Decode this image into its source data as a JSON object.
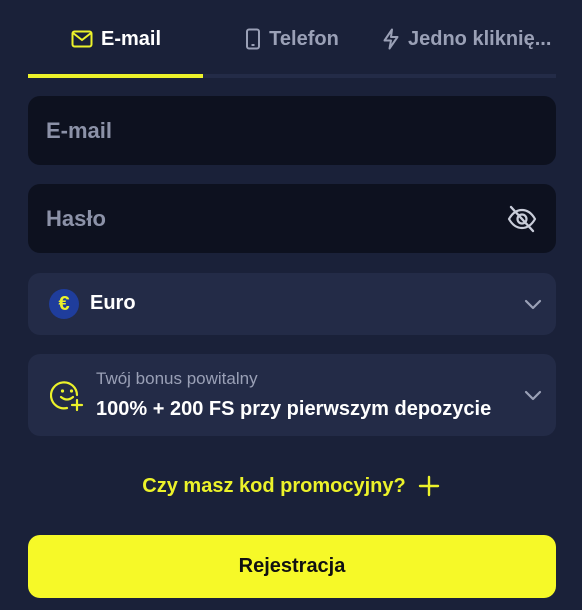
{
  "tabs": {
    "email": "E-mail",
    "phone": "Telefon",
    "one_click": "Jedno kliknię..."
  },
  "form": {
    "email_placeholder": "E-mail",
    "password_placeholder": "Hasło"
  },
  "currency": {
    "symbol": "€",
    "label": "Euro"
  },
  "bonus": {
    "caption": "Twój bonus powitalny",
    "value": "100% + 200 FS przy pierwszym depozycie"
  },
  "promo": {
    "label": "Czy masz kod promocyjny?"
  },
  "register": {
    "label": "Rejestracja"
  },
  "colors": {
    "background": "#1a2139",
    "accent": "#ecf22a",
    "input_bg": "#0d111f",
    "select_bg": "#232b47"
  },
  "icons": [
    "mail-icon",
    "phone-icon",
    "lightning-icon",
    "eye-off-icon",
    "euro-icon",
    "chevron-down-icon",
    "smiley-plus-icon",
    "plus-icon"
  ]
}
